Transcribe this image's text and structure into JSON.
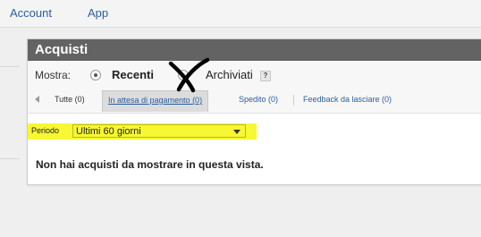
{
  "topnav": {
    "items": [
      {
        "label": "Account"
      },
      {
        "label": "App"
      }
    ]
  },
  "panel": {
    "title": "Acquisti",
    "show": {
      "label": "Mostra:",
      "options": [
        {
          "label": "Recenti",
          "selected": true
        },
        {
          "label": "Archiviati",
          "selected": false
        }
      ],
      "help": "?"
    },
    "tabs": [
      {
        "label": "Tutte (0)"
      },
      {
        "label": "In attesa di pagamento (0)",
        "active": true
      },
      {
        "label": "Spedito (0)"
      },
      {
        "label": "Feedback da lasciare (0)"
      }
    ],
    "period": {
      "label": "Periodo",
      "value": "Ultimi 60 giorni"
    },
    "empty_message": "Non hai acquisti da mostrare in questa vista."
  },
  "colors": {
    "header_bg": "#636363",
    "highlight": "#f7f733",
    "link": "#2b5fa0",
    "annotation": "#000000"
  },
  "icons": {
    "tab_back": "arrow-left-icon",
    "help": "help-icon",
    "dropdown": "chevron-down-icon",
    "annotation": "cross-mark-icon"
  }
}
